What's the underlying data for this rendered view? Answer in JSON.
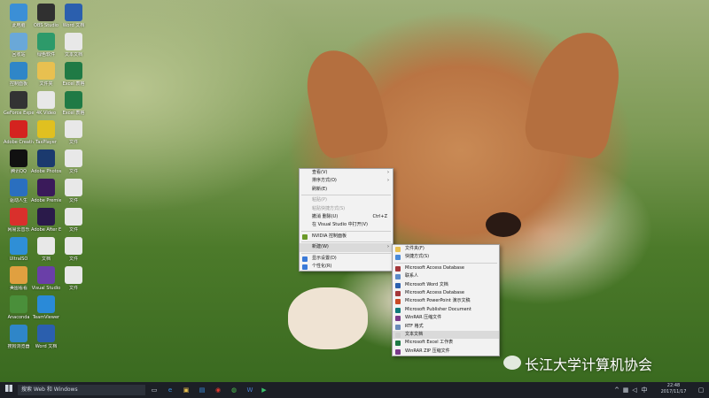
{
  "desktop_icons": [
    {
      "label": "此电脑",
      "icon": "computer-icon",
      "color": "#3b8fd6"
    },
    {
      "label": "回收站",
      "icon": "recycle-bin-icon",
      "color": "#6aa8d8"
    },
    {
      "label": "控制面板",
      "icon": "control-panel-icon",
      "color": "#2f86c8"
    },
    {
      "label": "GeForce Experience",
      "icon": "geforce-icon",
      "color": "#333333"
    },
    {
      "label": "Adobe Creative",
      "icon": "adobe-cc-icon",
      "color": "#d4231f"
    },
    {
      "label": "腾讯QQ",
      "icon": "qq-icon",
      "color": "#111111"
    },
    {
      "label": "驱动人生",
      "icon": "gear-icon",
      "color": "#2a6fbf"
    },
    {
      "label": "网易云音乐",
      "icon": "music-icon",
      "color": "#d9302c"
    },
    {
      "label": "UltraISO",
      "icon": "disc-icon",
      "color": "#2f8fd6"
    },
    {
      "label": "美图看看",
      "icon": "photo-icon",
      "color": "#e0a040"
    },
    {
      "label": "Anaconda",
      "icon": "python-icon",
      "color": "#4a8f3a"
    },
    {
      "label": "搜狗浏览器",
      "icon": "browser-icon",
      "color": "#2f86c8"
    },
    {
      "label": "OBS Studio",
      "icon": "obs-icon",
      "color": "#303030"
    },
    {
      "label": "绿色软件",
      "icon": "app-icon",
      "color": "#2d9a6a"
    },
    {
      "label": "文件夹",
      "icon": "folder-icon",
      "color": "#e8c050"
    },
    {
      "label": "4K Video",
      "icon": "video-icon",
      "color": "#e8e8e8"
    },
    {
      "label": "TaxPlayer",
      "icon": "player-icon",
      "color": "#e0c020"
    },
    {
      "label": "Adobe Photoshop",
      "icon": "ps-icon",
      "color": "#1b3a6e"
    },
    {
      "label": "Adobe Premiere Pro",
      "icon": "pr-icon",
      "color": "#3a1a5a"
    },
    {
      "label": "Adobe After Effects CC",
      "icon": "ae-icon",
      "color": "#2a1a4a"
    },
    {
      "label": "文档",
      "icon": "document-icon",
      "color": "#e8e8e8"
    },
    {
      "label": "Visual Studio",
      "icon": "visual-studio-icon",
      "color": "#6a3fa8"
    },
    {
      "label": "TeamViewer",
      "icon": "teamviewer-icon",
      "color": "#2a8ad8"
    },
    {
      "label": "Word 文档",
      "icon": "word-icon",
      "color": "#2b5fae"
    },
    {
      "label": "Word 文档",
      "icon": "word-icon",
      "color": "#2b5fae"
    },
    {
      "label": "文本文档",
      "icon": "text-file-icon",
      "color": "#e8e8e8"
    },
    {
      "label": "Excel 表格",
      "icon": "excel-icon",
      "color": "#1f7a45"
    },
    {
      "label": "Excel 表格",
      "icon": "excel-icon",
      "color": "#1f7a45"
    },
    {
      "label": "文件",
      "icon": "file-icon",
      "color": "#e8e8e8"
    },
    {
      "label": "文件",
      "icon": "file-icon",
      "color": "#e8e8e8"
    },
    {
      "label": "文件",
      "icon": "file-icon",
      "color": "#e8e8e8"
    },
    {
      "label": "文件",
      "icon": "file-icon",
      "color": "#e8e8e8"
    },
    {
      "label": "文件",
      "icon": "file-icon",
      "color": "#e8e8e8"
    },
    {
      "label": "文件",
      "icon": "file-icon",
      "color": "#e8e8e8"
    }
  ],
  "context_menu": [
    {
      "label": "查看(V)",
      "arrow": true
    },
    {
      "label": "排序方式(O)",
      "arrow": true
    },
    {
      "label": "刷新(E)"
    },
    {
      "sep": true
    },
    {
      "label": "粘贴(P)",
      "disabled": true
    },
    {
      "label": "粘贴快捷方式(S)",
      "disabled": true
    },
    {
      "label": "撤消 删除(U)",
      "shortcut": "Ctrl+Z"
    },
    {
      "label": "在 Visual Studio 中打开(V)"
    },
    {
      "sep": true
    },
    {
      "label": "NVIDIA 控制面板",
      "icon_color": "#6b9a2a"
    },
    {
      "sep": true
    },
    {
      "label": "新建(W)",
      "arrow": true,
      "highlight": true
    },
    {
      "sep": true
    },
    {
      "label": "显示设置(D)",
      "icon_color": "#3a7ad8"
    },
    {
      "label": "个性化(R)",
      "icon_color": "#3a7ad8"
    }
  ],
  "submenu_new": [
    {
      "label": "文件夹(F)",
      "icon_color": "#e8c050"
    },
    {
      "label": "快捷方式(S)",
      "icon_color": "#4a8ad8"
    },
    {
      "sep": true
    },
    {
      "label": "Microsoft Access Database",
      "icon_color": "#a4373a"
    },
    {
      "label": "联系人",
      "icon_color": "#5a8ac8"
    },
    {
      "label": "Microsoft Word 文档",
      "icon_color": "#2b5fae"
    },
    {
      "label": "Microsoft Access Database",
      "icon_color": "#a4373a"
    },
    {
      "label": "Microsoft PowerPoint 演示文稿",
      "icon_color": "#c84a25"
    },
    {
      "label": "Microsoft Publisher Document",
      "icon_color": "#0f7a7a"
    },
    {
      "label": "WinRAR 压缩文件",
      "icon_color": "#7a3a8a"
    },
    {
      "label": "RTF 格式",
      "icon_color": "#6a8ab8"
    },
    {
      "label": "文本文档",
      "icon_color": "#cfcfcf",
      "highlight": true
    },
    {
      "label": "Microsoft Excel 工作表",
      "icon_color": "#1f7a45"
    },
    {
      "label": "WinRAR ZIP 压缩文件",
      "icon_color": "#7a3a8a"
    }
  ],
  "taskbar": {
    "search_placeholder": "搜索 Web 和 Windows",
    "time": "22:48",
    "date": "2017/11/17",
    "ime_label": "中"
  },
  "watermark": {
    "text": "长江大学计算机协会"
  }
}
